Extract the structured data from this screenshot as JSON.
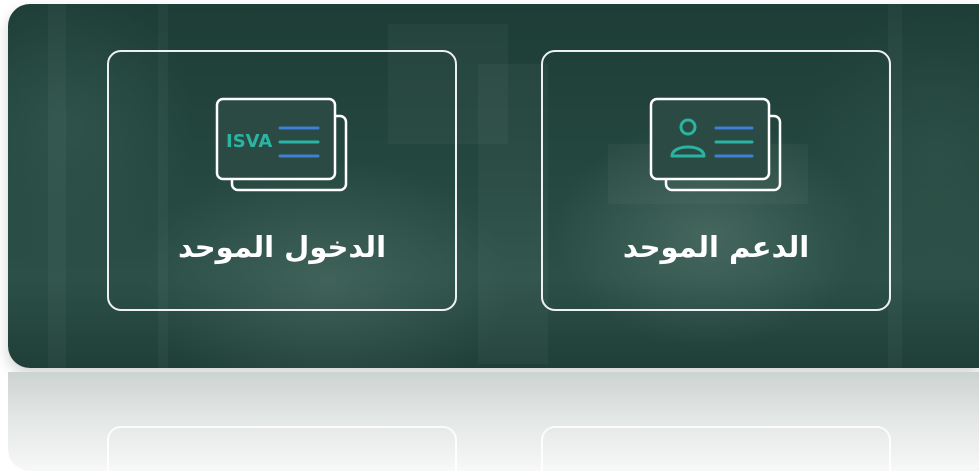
{
  "login_card": {
    "label": "الدخول الموحد",
    "badge": "ISVA",
    "icon": "id-card-isva-icon"
  },
  "support_card": {
    "label": "الدعم الموحد",
    "icon": "user-id-card-icon"
  },
  "colors": {
    "panel": "#24473f",
    "card_border": "#ffffff",
    "badge_text": "#2bb3a3",
    "line_blue": "#3f7fd6",
    "line_teal": "#2bb3a3",
    "person": "#2bb3a3"
  }
}
